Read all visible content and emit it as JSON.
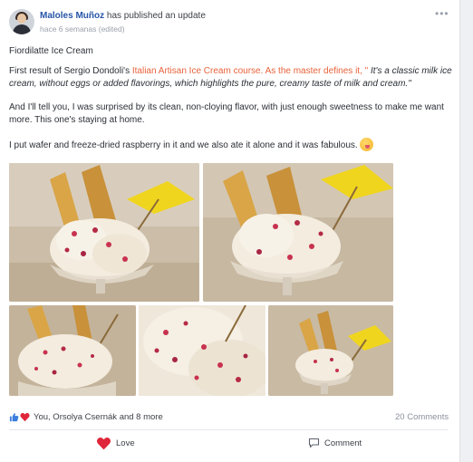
{
  "post": {
    "author": "Maloles Muñoz",
    "action_text": "has published an update",
    "time_ago": "hace 6 semanas",
    "edited_label": "(edited)",
    "more_icon": "ellipsis-icon",
    "title": "Fiordilatte Ice Cream",
    "p1_prefix": "First result of Sergio Dondoli's ",
    "p1_link": "Italian Artisan Ice Cream course. As the master defines it, \"",
    "p1_quote": " It's a classic milk ice cream, without eggs or added flavorings, which highlights the pure, creamy taste of milk and cream.\"",
    "p2": "And I'll tell you, I was surprised by its clean, non-cloying flavor, with just enough sweetness to make me want more. This one's staying at home.",
    "p3": "I put wafer and freeze-dried raspberry in it and we also ate it alone and it was fabulous.",
    "emoji_icon": "yum-face-emoji",
    "link_color": "#e8623a",
    "author_color": "#2554a8"
  },
  "reactions": {
    "summary": "You, Orsolya Csernák and 8 more",
    "comments_count": "20 Comments",
    "like_color": "#3b7ddd",
    "heart_color": "#e0263a"
  },
  "actions": {
    "love_label": "Love",
    "comment_label": "Comment"
  }
}
